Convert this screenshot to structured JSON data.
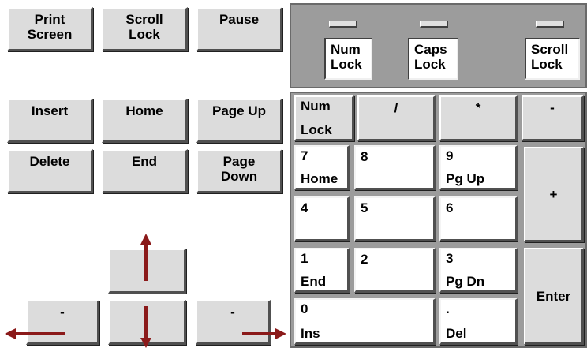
{
  "nav_keys": {
    "print_screen": [
      "Print",
      "Screen"
    ],
    "scroll_lock": [
      "Scroll",
      "Lock"
    ],
    "pause": "Pause",
    "insert": "Insert",
    "home": "Home",
    "page_up": "Page Up",
    "delete": "Delete",
    "end": "End",
    "page_down": [
      "Page",
      "Down"
    ]
  },
  "arrow_keys": {
    "left": "-",
    "right": "-"
  },
  "indicators": {
    "num_lock": [
      "Num",
      "Lock"
    ],
    "caps_lock": [
      "Caps",
      "Lock"
    ],
    "scroll_lock": [
      "Scroll",
      "Lock"
    ]
  },
  "numpad": {
    "num_lock": [
      "Num",
      "Lock"
    ],
    "divide": "/",
    "multiply": "*",
    "minus": "-",
    "plus": "+",
    "enter": "Enter",
    "k7": [
      "7",
      "Home"
    ],
    "k8": "8",
    "k9": [
      "9",
      "Pg Up"
    ],
    "k4": "4",
    "k5": "5",
    "k6": "6",
    "k1": [
      "1",
      "End"
    ],
    "k2": "2",
    "k3": [
      "3",
      "Pg Dn"
    ],
    "k0": [
      "0",
      "Ins"
    ],
    "decimal": [
      ".",
      "Del"
    ]
  },
  "colors": {
    "key_face": "#dcdcdc",
    "panel": "#9c9c9c",
    "arrow": "#8b1a1a"
  }
}
